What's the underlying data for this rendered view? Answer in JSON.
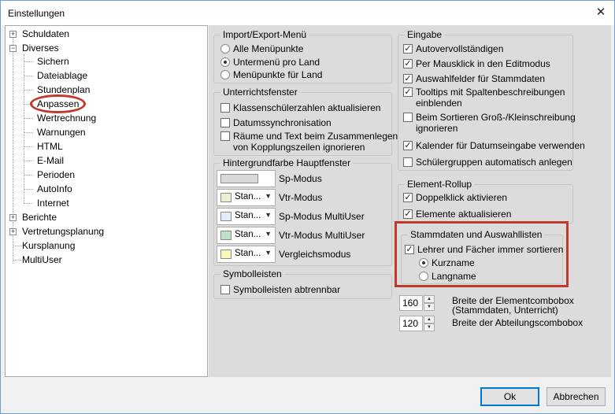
{
  "window": {
    "title": "Einstellungen",
    "close": "✕"
  },
  "tree": {
    "items": [
      {
        "label": "Schuldaten",
        "expander": "+"
      },
      {
        "label": "Diverses",
        "expander": "−"
      },
      {
        "label": "Sichern"
      },
      {
        "label": "Dateiablage"
      },
      {
        "label": "Stundenplan"
      },
      {
        "label": "Anpassen"
      },
      {
        "label": "Wertrechnung"
      },
      {
        "label": "Warnungen"
      },
      {
        "label": "HTML"
      },
      {
        "label": "E-Mail"
      },
      {
        "label": "Perioden"
      },
      {
        "label": "AutoInfo"
      },
      {
        "label": "Internet"
      },
      {
        "label": "Berichte",
        "expander": "+"
      },
      {
        "label": "Vertretungsplanung",
        "expander": "+"
      },
      {
        "label": "Kursplanung"
      },
      {
        "label": "MultiUser"
      }
    ]
  },
  "import_export": {
    "title": "Import/Export-Menü",
    "options": [
      "Alle Menüpunkte",
      "Untermenü pro Land",
      "Menüpunkte für Land"
    ],
    "selected": 1
  },
  "unterricht": {
    "title": "Unterrichtsfenster",
    "options": [
      "Klassenschülerzahlen aktualisieren",
      "Datumssynchronisation",
      "Räume und Text beim Zusammenlegen",
      "von Kopplungszeilen ignorieren"
    ]
  },
  "hintergrund": {
    "title": "Hintergrundfarbe Hauptfenster",
    "rows": [
      {
        "sel": "",
        "label": "Sp-Modus",
        "color": "#d3d3d3"
      },
      {
        "sel": "Stan...",
        "label": "Vtr-Modus",
        "color": "#eeeed2"
      },
      {
        "sel": "Stan...",
        "label": "Sp-Modus MultiUser",
        "color": "#dfeefa"
      },
      {
        "sel": "Stan...",
        "label": "Vtr-Modus MultiUser",
        "color": "#bfe0cf"
      },
      {
        "sel": "Stan...",
        "label": "Vergleichsmodus",
        "color": "#fdf7b6"
      }
    ]
  },
  "symbolleisten": {
    "title": "Symbolleisten",
    "option": "Symbolleisten abtrennbar"
  },
  "eingabe": {
    "title": "Eingabe",
    "options": [
      "Autovervollständigen",
      "Per Mausklick in den Editmodus",
      "Auswahlfelder für Stammdaten",
      "Tooltips mit Spaltenbeschreibungen",
      "einblenden",
      "Beim Sortieren Groß-/Kleinschreibung",
      "ignorieren",
      "Kalender für Datumseingabe verwenden",
      "Schülergruppen automatisch anlegen"
    ]
  },
  "element_rollup": {
    "title": "Element-Rollup",
    "options": [
      "Doppelklick aktivieren",
      "Elemente aktualisieren"
    ]
  },
  "stammdaten": {
    "title": "Stammdaten und Auswahllisten",
    "check": "Lehrer und Fächer immer sortieren",
    "radios": [
      "Kurzname",
      "Langname"
    ],
    "selected": 0
  },
  "combobox": {
    "element_value": "160",
    "element_label_1": "Breite der Elementcombobox",
    "element_label_2": "(Stammdaten, Unterricht)",
    "abteilung_value": "120",
    "abteilung_label": "Breite der Abteilungscombobox"
  },
  "buttons": {
    "ok": "Ok",
    "cancel": "Abbrechen"
  }
}
